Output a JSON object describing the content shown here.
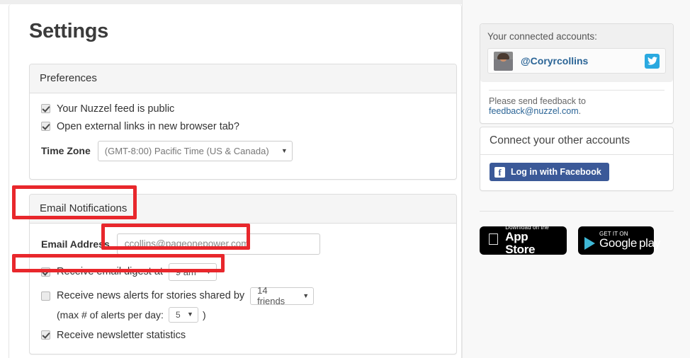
{
  "page": {
    "title": "Settings"
  },
  "preferences": {
    "heading": "Preferences",
    "checkboxes": [
      {
        "label": "Your Nuzzel feed is public",
        "checked": true
      },
      {
        "label": "Open external links in new browser tab?",
        "checked": true
      }
    ],
    "timezone": {
      "label": "Time Zone",
      "value": "(GMT-8:00) Pacific Time (US & Canada)",
      "caret": "▼"
    }
  },
  "email_notifications": {
    "heading": "Email Notifications",
    "email_address": {
      "label": "Email Address",
      "value": "ccollins@pageonepower.com"
    },
    "digest": {
      "label": "Receive email digest at",
      "checked": true,
      "time_value": "9 am",
      "caret": "▼"
    },
    "news_alerts": {
      "label": "Receive news alerts for stories shared by",
      "checked": false,
      "friends_value": "14 friends",
      "caret": "▼"
    },
    "max_alerts": {
      "prefix": "(max # of alerts per day:",
      "value": "5",
      "suffix": ")",
      "caret": "▼"
    },
    "newsletter_stats": {
      "label": "Receive newsletter statistics",
      "checked": true
    }
  },
  "sidebar": {
    "connected_accounts": {
      "title": "Your connected accounts:",
      "account": {
        "handle": "@Coryrcollins",
        "network_icon": "twitter-icon"
      },
      "feedback_prefix": "Please send feedback to ",
      "feedback_link": "feedback@nuzzel.com",
      "feedback_suffix": "."
    },
    "connect_other": {
      "heading": "Connect your other accounts",
      "facebook_button": "Log in with Facebook",
      "facebook_glyph": "f"
    },
    "store_badges": {
      "apple": {
        "small": "Download on the",
        "big": "App Store",
        "icon": "apple-icon"
      },
      "google": {
        "small": "GET IT ON",
        "big": "Google",
        "big_thin": "play",
        "icon": "google-play-icon"
      }
    }
  },
  "annotations": {
    "color": "#e8272c",
    "boxes": [
      {
        "name": "email-notifications-heading"
      },
      {
        "name": "email-address-field"
      },
      {
        "name": "email-digest-row"
      }
    ]
  }
}
